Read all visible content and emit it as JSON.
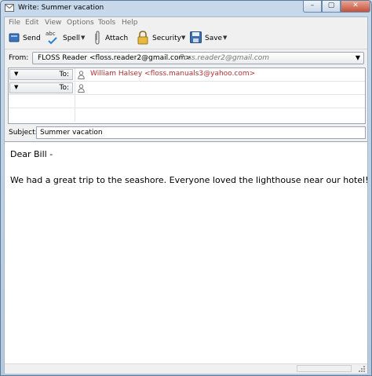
{
  "window": {
    "title": "Write: Summer vacation",
    "controls": {
      "minimize": "–",
      "maximize": "▢",
      "close": "✕"
    }
  },
  "menu": [
    {
      "label": "File"
    },
    {
      "label": "Edit"
    },
    {
      "label": "View"
    },
    {
      "label": "Options"
    },
    {
      "label": "Tools"
    },
    {
      "label": "Help"
    }
  ],
  "toolbar": {
    "send": {
      "label": "Send",
      "icon": "send-icon"
    },
    "spell": {
      "label": "Spell",
      "icon": "spell-check-icon",
      "icon_text": "abc"
    },
    "attach": {
      "label": "Attach",
      "icon": "paperclip-icon"
    },
    "security": {
      "label": "Security",
      "icon": "padlock-icon"
    },
    "save": {
      "label": "Save",
      "icon": "floppy-disk-icon"
    },
    "caret": "▼"
  },
  "from": {
    "label": "From:",
    "name": "FLOSS Reader <floss.reader2@gmail.com>",
    "alias": "floss.reader2@gmail.com",
    "arrow": "▼"
  },
  "recipients": [
    {
      "type": "To:",
      "value": "William Halsey <floss.manuals3@yahoo.com>"
    },
    {
      "type": "To:",
      "value": ""
    }
  ],
  "subject": {
    "label": "Subject:",
    "value": "Summer vacation"
  },
  "body": {
    "greeting": "Dear Bill -",
    "paragraph": "We had a great trip to the seashore. Everyone loved the lighthouse near our hotel!"
  },
  "colors": {
    "recipient_text": "#b03030",
    "window_frame": "#b4c9df",
    "close_button": "#c4513a"
  }
}
